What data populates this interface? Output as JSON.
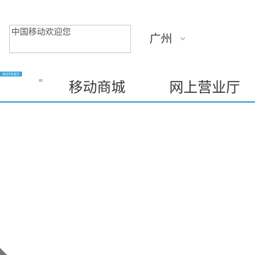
{
  "header": {
    "search": {
      "text": "中国移动欢迎您"
    },
    "city": {
      "label": "广州",
      "icon": "chevron-down-icon"
    }
  },
  "nav": {
    "badge_text": "移动手机首页",
    "small_mark": "=",
    "tabs": [
      {
        "label": "移动商城"
      },
      {
        "label": "网上营业厅"
      }
    ],
    "accent_color": "#3aa7d8"
  },
  "footer": {
    "corner_icon": "resize-handle-icon"
  }
}
